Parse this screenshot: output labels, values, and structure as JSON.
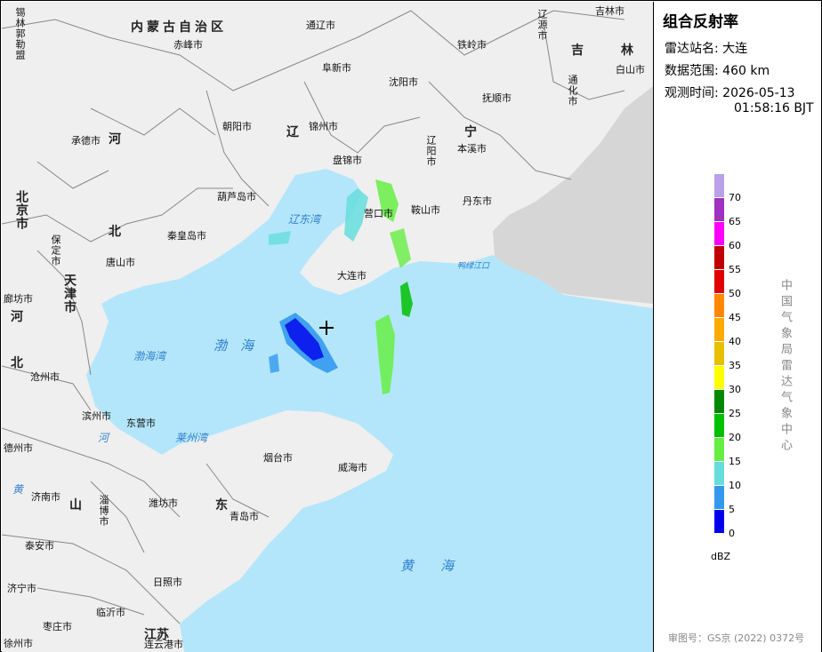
{
  "panel": {
    "product_title": "组合反射率",
    "station_label": "雷达站名:",
    "station_value": "大连",
    "range_label": "数据范围:",
    "range_value": "460 km",
    "time_label": "观测时间:",
    "time_date": "2026-05-13",
    "time_clock": "01:58:16 BJT",
    "unit": "dBZ",
    "publisher": "中国气象局雷达气象中心",
    "approval": "审图号：GS京 (2022) 0372号"
  },
  "legend": [
    {
      "label": "70",
      "color": "#b9a0e8"
    },
    {
      "label": "65",
      "color": "#a030c0"
    },
    {
      "label": "60",
      "color": "#ff00ff"
    },
    {
      "label": "55",
      "color": "#c00000"
    },
    {
      "label": "50",
      "color": "#e00000"
    },
    {
      "label": "45",
      "color": "#ff8800"
    },
    {
      "label": "40",
      "color": "#ffaa00"
    },
    {
      "label": "35",
      "color": "#e8c000"
    },
    {
      "label": "30",
      "color": "#ffff00"
    },
    {
      "label": "25",
      "color": "#008800"
    },
    {
      "label": "20",
      "color": "#00c000"
    },
    {
      "label": "15",
      "color": "#66ee44"
    },
    {
      "label": "10",
      "color": "#66dddd"
    },
    {
      "label": "5",
      "color": "#3399ee"
    },
    {
      "label": "0",
      "color": "#0000ee"
    }
  ],
  "map": {
    "colors": {
      "land": "#efefef",
      "sea": "#b3e6fa",
      "foreign": "#d6d6d6",
      "border": "#888888"
    },
    "cities": [
      {
        "id": "tongliao",
        "name": "通辽市"
      },
      {
        "id": "chifeng",
        "name": "赤峰市"
      },
      {
        "id": "fuxin",
        "name": "阜新市"
      },
      {
        "id": "tieling",
        "name": "铁岭市"
      },
      {
        "id": "shenyang",
        "name": "沈阳市"
      },
      {
        "id": "fushun",
        "name": "抚顺市"
      },
      {
        "id": "jilin",
        "name": "吉林市"
      },
      {
        "id": "baishan",
        "name": "白山市"
      },
      {
        "id": "chaoyang",
        "name": "朝阳市"
      },
      {
        "id": "jinzhou",
        "name": "锦州市"
      },
      {
        "id": "chengde",
        "name": "承德市"
      },
      {
        "id": "benxi",
        "name": "本溪市"
      },
      {
        "id": "panjin",
        "name": "盘锦市"
      },
      {
        "id": "huludao",
        "name": "葫芦岛市"
      },
      {
        "id": "yingkou",
        "name": "营口市"
      },
      {
        "id": "anshan",
        "name": "鞍山市"
      },
      {
        "id": "dandong",
        "name": "丹东市"
      },
      {
        "id": "qinhuangdao",
        "name": "秦皇岛市"
      },
      {
        "id": "tangshan",
        "name": "唐山市"
      },
      {
        "id": "dalian",
        "name": "大连市"
      },
      {
        "id": "langfang",
        "name": "廊坊市"
      },
      {
        "id": "cangzhou",
        "name": "沧州市"
      },
      {
        "id": "binzhou",
        "name": "滨州市"
      },
      {
        "id": "dongying",
        "name": "东营市"
      },
      {
        "id": "dezhou",
        "name": "德州市"
      },
      {
        "id": "yantai",
        "name": "烟台市"
      },
      {
        "id": "weihai",
        "name": "威海市"
      },
      {
        "id": "jinan",
        "name": "济南市"
      },
      {
        "id": "weifang",
        "name": "潍坊市"
      },
      {
        "id": "qingdao",
        "name": "青岛市"
      },
      {
        "id": "taian",
        "name": "泰安市"
      },
      {
        "id": "rizhao",
        "name": "日照市"
      },
      {
        "id": "jining",
        "name": "济宁市"
      },
      {
        "id": "linyi",
        "name": "临沂市"
      },
      {
        "id": "zaozhuang",
        "name": "枣庄市"
      },
      {
        "id": "xuzhou",
        "name": "徐州市"
      },
      {
        "id": "lianyungang",
        "name": "连云港市"
      }
    ],
    "vertical_cities": [
      {
        "id": "xilinguole",
        "name": "锡林郭勒盟"
      },
      {
        "id": "liaoyuan",
        "name": "辽源市"
      },
      {
        "id": "tonghua",
        "name": "通化市"
      },
      {
        "id": "liaoyang",
        "name": "辽阳市"
      },
      {
        "id": "zibo",
        "name": "淄博市"
      },
      {
        "id": "beijingcity",
        "name": "北京市"
      },
      {
        "id": "baoding",
        "name": "保定市"
      },
      {
        "id": "tianjincity",
        "name": "天津市"
      },
      {
        "id": "langfang2",
        "name": "廊坊市"
      }
    ],
    "provinces": [
      {
        "id": "neimenggu",
        "name": "内蒙古自治区"
      },
      {
        "id": "hebei",
        "name": "河"
      },
      {
        "id": "liao",
        "name": "辽"
      },
      {
        "id": "ning",
        "name": "宁"
      },
      {
        "id": "ji",
        "name": "吉"
      },
      {
        "id": "lin",
        "name": "林"
      },
      {
        "id": "bei",
        "name": "北"
      },
      {
        "id": "hebei2",
        "name": "河"
      },
      {
        "id": "bei2",
        "name": "北"
      },
      {
        "id": "shan",
        "name": "山"
      },
      {
        "id": "dong",
        "name": "东"
      },
      {
        "id": "jiangsu",
        "name": "江苏"
      }
    ],
    "waters": [
      {
        "id": "liaodongwan",
        "name": "辽东湾"
      },
      {
        "id": "bohaiwan",
        "name": "渤海湾"
      },
      {
        "id": "bohai",
        "name": "渤　海"
      },
      {
        "id": "laizhouwan",
        "name": "莱州湾"
      },
      {
        "id": "huanghai",
        "name": "黄　　海"
      },
      {
        "id": "yalujiang",
        "name": "鸭绿江口"
      },
      {
        "id": "he",
        "name": "河"
      },
      {
        "id": "huang",
        "name": "黄"
      }
    ]
  }
}
